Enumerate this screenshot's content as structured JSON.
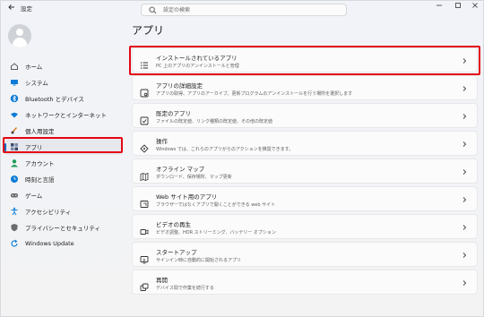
{
  "window": {
    "title": "設定"
  },
  "search": {
    "placeholder": "設定の検索"
  },
  "sidebar": {
    "items": [
      {
        "label": "ホーム",
        "icon": "home-icon",
        "color": "#5b5b5b"
      },
      {
        "label": "システム",
        "icon": "system-icon",
        "color": "#0a7bd6"
      },
      {
        "label": "Bluetooth とデバイス",
        "icon": "bluetooth-icon",
        "color": "#0a7bd6"
      },
      {
        "label": "ネットワークとインターネット",
        "icon": "wifi-icon",
        "color": "#0a7bd6"
      },
      {
        "label": "個人用設定",
        "icon": "brush-icon",
        "color": "#d9822b"
      },
      {
        "label": "アプリ",
        "icon": "apps-icon",
        "color": "#3b4a6b"
      },
      {
        "label": "アカウント",
        "icon": "account-icon",
        "color": "#1e9e5a"
      },
      {
        "label": "時刻と言語",
        "icon": "time-language-icon",
        "color": "#0a7bd6"
      },
      {
        "label": "ゲーム",
        "icon": "gamepad-icon",
        "color": "#6b6b6b"
      },
      {
        "label": "アクセシビリティ",
        "icon": "accessibility-icon",
        "color": "#0a7bd6"
      },
      {
        "label": "プライバシーとセキュリティ",
        "icon": "shield-icon",
        "color": "#6b6b6b"
      },
      {
        "label": "Windows Update",
        "icon": "update-icon",
        "color": "#0a7bd6"
      }
    ],
    "active_index": 5
  },
  "main": {
    "title": "アプリ",
    "cards": [
      {
        "title": "インストールされているアプリ",
        "subtitle": "PC 上のアプリのアンインストールと管理",
        "icon": "list-icon"
      },
      {
        "title": "アプリの詳細設定",
        "subtitle": "アプリの取得、アプリのアーカイブ、更新プログラムのアンインストールを行う場所を選択します",
        "icon": "app-settings-icon"
      },
      {
        "title": "既定のアプリ",
        "subtitle": "ファイルの既定値、リンク種類の既定値、その他の既定値",
        "icon": "default-apps-icon"
      },
      {
        "title": "操作",
        "subtitle": "Windows では、これらのアプリがらのアクションを推奨できます。",
        "icon": "actions-icon"
      },
      {
        "title": "オフライン マップ",
        "subtitle": "ダウンロード、保存場所、マップ更新",
        "icon": "map-icon"
      },
      {
        "title": "Web サイト用のアプリ",
        "subtitle": "ブラウザーではなくアプリで開くことができる web サイト",
        "icon": "web-apps-icon"
      },
      {
        "title": "ビデオの再生",
        "subtitle": "ビデオ調整、HDR ストリーミング、バッテリー オプション",
        "icon": "video-icon"
      },
      {
        "title": "スタートアップ",
        "subtitle": "サインイン時に自動的に開始されるアプリ",
        "icon": "startup-icon"
      },
      {
        "title": "再開",
        "subtitle": "デバイス間で作業を続行する",
        "icon": "resume-icon"
      }
    ]
  },
  "highlight_color": "#e30613",
  "accent_color": "#0067c0"
}
